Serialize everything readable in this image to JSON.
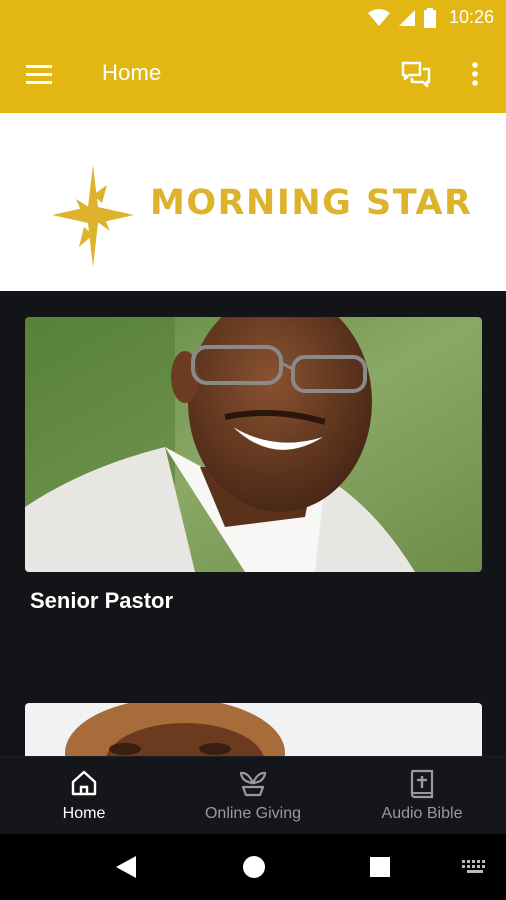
{
  "status_bar": {
    "time": "10:26",
    "icons": [
      "wifi-icon",
      "signal-icon",
      "battery-icon"
    ]
  },
  "app_bar": {
    "title": "Home",
    "icons": [
      "menu-icon",
      "chat-icon",
      "more-vert-icon"
    ],
    "color": "#E2B714"
  },
  "banner": {
    "logo_text": "MORNING STAR",
    "logo_color": "#DDB32B"
  },
  "cards": [
    {
      "title": "Senior Pastor",
      "image": "portrait of smiling man with glasses in white jacket"
    },
    {
      "title": "",
      "image": "partial portrait of woman with curly hair"
    }
  ],
  "bottom_nav": {
    "items": [
      {
        "label": "Home",
        "icon": "home-icon",
        "active": true
      },
      {
        "label": "Online Giving",
        "icon": "giving-plant-icon",
        "active": false
      },
      {
        "label": "Audio Bible",
        "icon": "bible-icon",
        "active": false
      }
    ]
  },
  "system_nav": {
    "icons": [
      "back-icon",
      "home-circle-icon",
      "recents-icon",
      "keyboard-icon"
    ]
  }
}
